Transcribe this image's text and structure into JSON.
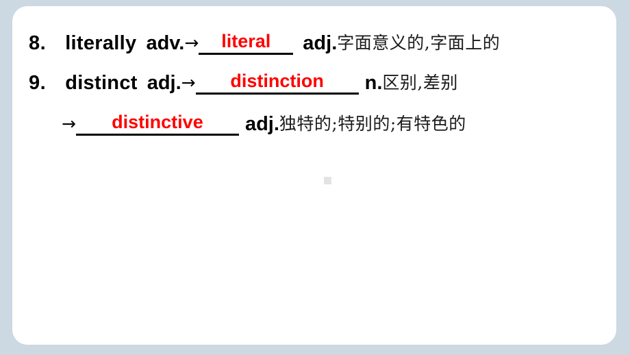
{
  "slide": {
    "background_color": "#ccd8e2",
    "card_color": "#ffffff",
    "answer_color": "#ff0000",
    "text_color": "#000000"
  },
  "entries": [
    {
      "number": "8.",
      "word": "literally",
      "pos_source": "adv.",
      "arrow": "→",
      "answer": "literal",
      "pos_target": "adj.",
      "meaning": "字面意义的,字面上的"
    },
    {
      "number": "9.",
      "word": "distinct",
      "pos_source": "adj.",
      "arrow": "→",
      "answer": "distinction",
      "pos_target": "n.",
      "meaning": "区别,差别"
    },
    {
      "number": "",
      "word": "",
      "pos_source": "",
      "arrow": "→",
      "answer": "distinctive",
      "pos_target": "adj.",
      "meaning": "独特的;特别的;有特色的"
    }
  ],
  "marker": {
    "name": "placeholder-dot",
    "color": "#e3e3e3"
  }
}
